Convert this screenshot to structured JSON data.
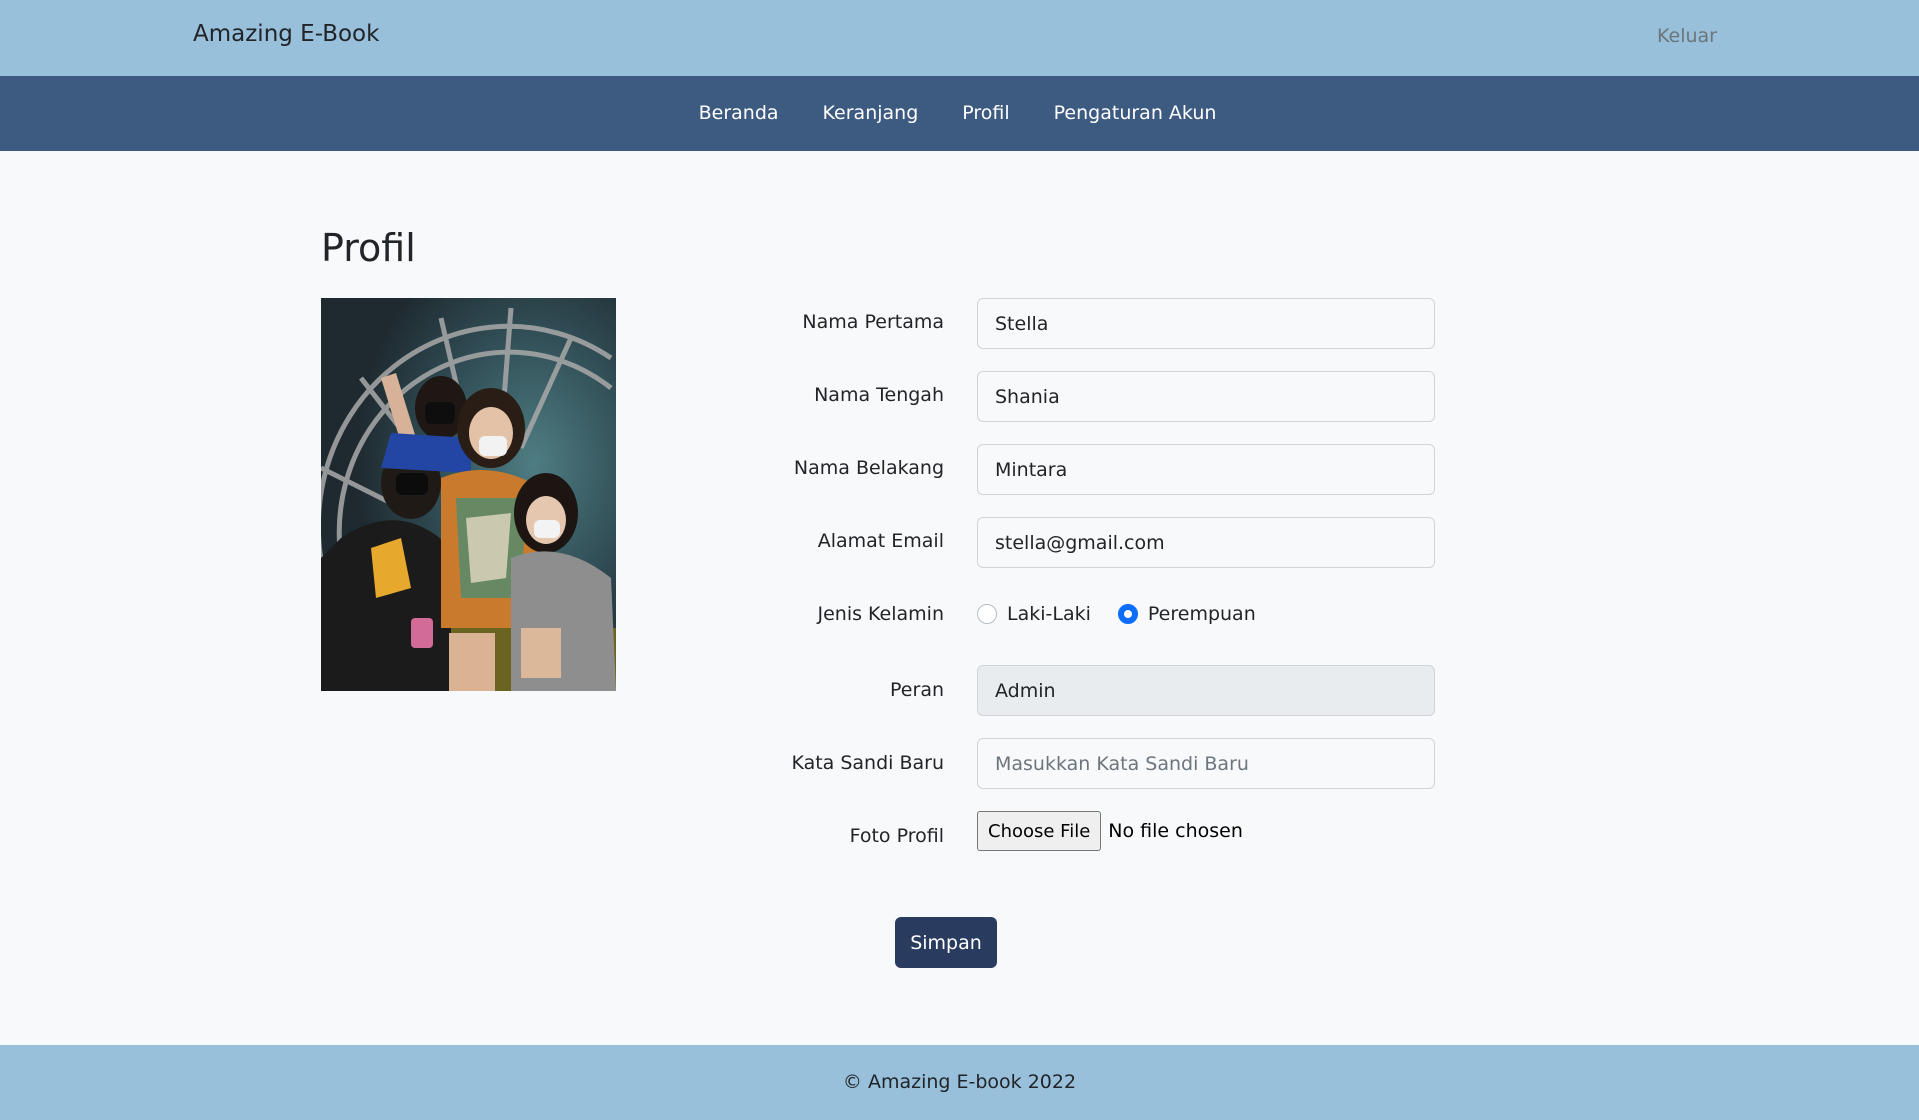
{
  "header": {
    "brand": "Amazing E-Book",
    "logout_label": "Keluar"
  },
  "nav": {
    "items": [
      {
        "label": "Beranda"
      },
      {
        "label": "Keranjang"
      },
      {
        "label": "Profil"
      },
      {
        "label": "Pengaturan Akun"
      }
    ]
  },
  "page": {
    "title": "Profil"
  },
  "form": {
    "first_name": {
      "label": "Nama Pertama",
      "value": "Stella"
    },
    "middle_name": {
      "label": "Nama Tengah",
      "value": "Shania"
    },
    "last_name": {
      "label": "Nama Belakang",
      "value": "Mintara"
    },
    "email": {
      "label": "Alamat Email",
      "value": "stella@gmail.com"
    },
    "gender": {
      "label": "Jenis Kelamin",
      "options": [
        {
          "label": "Laki-Laki",
          "checked": false
        },
        {
          "label": "Perempuan",
          "checked": true
        }
      ]
    },
    "role": {
      "label": "Peran",
      "value": "Admin"
    },
    "new_password": {
      "label": "Kata Sandi Baru",
      "value": "",
      "placeholder": "Masukkan Kata Sandi Baru"
    },
    "photo": {
      "label": "Foto Profil",
      "button_label": "Choose File",
      "status": "No file chosen"
    },
    "submit_label": "Simpan"
  },
  "footer": {
    "text": "© Amazing E-book 2022"
  },
  "colors": {
    "topbar": "#98c0da",
    "navbar": "#3d5a80",
    "save_button": "#293b5f",
    "radio_checked": "#0d6efd"
  }
}
